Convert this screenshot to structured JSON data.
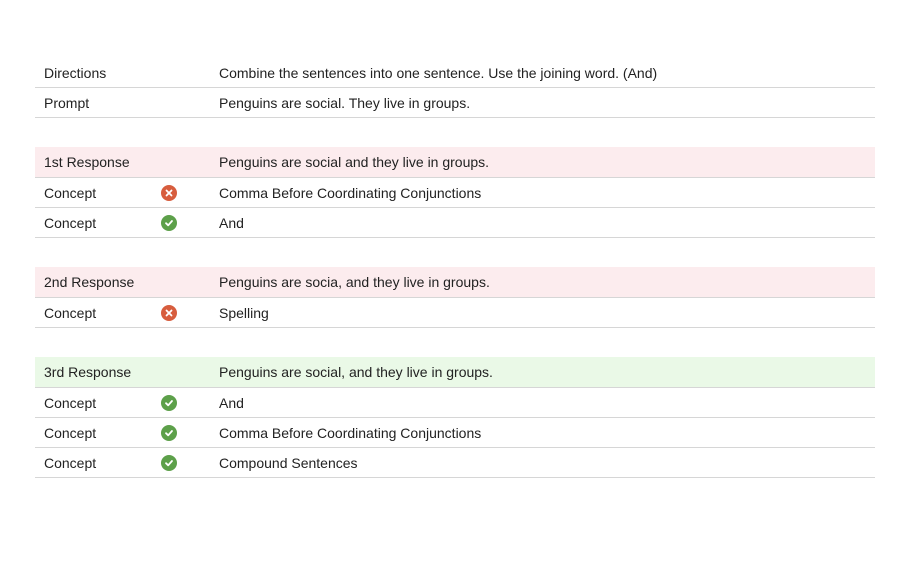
{
  "intro": {
    "directions_label": "Directions",
    "directions_text": "Combine the sentences into one sentence. Use the joining word. (And)",
    "prompt_label": "Prompt",
    "prompt_text": "Penguins are social. They live in groups."
  },
  "responses": [
    {
      "label": "1st Response",
      "text": "Penguins are social and they live in groups.",
      "status": "incorrect",
      "concepts": [
        {
          "label": "Concept",
          "result": "incorrect",
          "icon": "x-circle-icon",
          "name": "Comma Before Coordinating Conjunctions"
        },
        {
          "label": "Concept",
          "result": "correct",
          "icon": "check-circle-icon",
          "name": "And"
        }
      ]
    },
    {
      "label": "2nd Response",
      "text": "Penguins are socia, and they live in groups.",
      "status": "incorrect",
      "concepts": [
        {
          "label": "Concept",
          "result": "incorrect",
          "icon": "x-circle-icon",
          "name": "Spelling"
        }
      ]
    },
    {
      "label": "3rd Response",
      "text": "Penguins are social, and they live in groups.",
      "status": "correct",
      "concepts": [
        {
          "label": "Concept",
          "result": "correct",
          "icon": "check-circle-icon",
          "name": "And"
        },
        {
          "label": "Concept",
          "result": "correct",
          "icon": "check-circle-icon",
          "name": "Comma Before Coordinating Conjunctions"
        },
        {
          "label": "Concept",
          "result": "correct",
          "icon": "check-circle-icon",
          "name": "Compound Sentences"
        }
      ]
    }
  ],
  "colors": {
    "incorrect_row_bg": "#fcecee",
    "correct_row_bg": "#eaf9e7",
    "incorrect_icon": "#d75d3e",
    "correct_icon": "#5da04a"
  }
}
